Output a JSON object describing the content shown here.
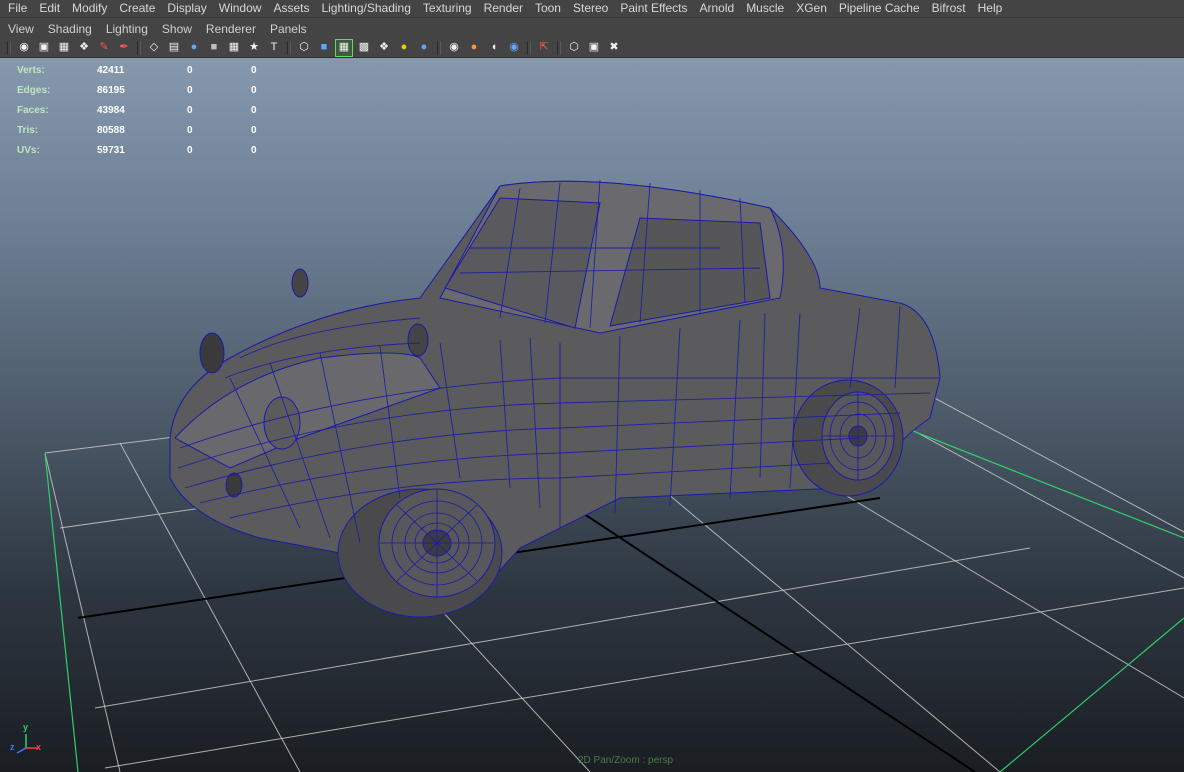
{
  "menu": [
    "File",
    "Edit",
    "Modify",
    "Create",
    "Display",
    "Window",
    "Assets",
    "Lighting/Shading",
    "Texturing",
    "Render",
    "Toon",
    "Stereo",
    "Paint Effects",
    "Arnold",
    "Muscle",
    "XGen",
    "Pipeline Cache",
    "Bifrost",
    "Help"
  ],
  "panel_menu": [
    "View",
    "Shading",
    "Lighting",
    "Show",
    "Renderer",
    "Panels"
  ],
  "toolbar_icons": [
    "camera-attributes-icon",
    "bookmark-icon",
    "image-plane-icon",
    "2d-pan-zoom-icon",
    "grease-pencil-icon",
    "paint-tool-icon",
    "wireframe-icon",
    "smooth-shade-icon",
    "wireframe-on-shaded-icon",
    "xray-icon",
    "xray-joints-icon",
    "isolate-icon",
    "resolution-gate-icon",
    "default-material-icon",
    "smooth-shaded-all-icon",
    "textured-icon",
    "checker-icon",
    "shadows-icon",
    "lights-icon",
    "ambient-occlusion-icon",
    "motion-blur-icon",
    "anti-aliasing-icon",
    "depth-of-field-icon",
    "select-camera-icon",
    "isolate-select-icon",
    "hud-icon",
    "toggle-gate-icon",
    "share-icon"
  ],
  "hud": {
    "rows": [
      {
        "label": "Verts:",
        "v1": "42411",
        "v2": "0",
        "v3": "0"
      },
      {
        "label": "Edges:",
        "v1": "86195",
        "v2": "0",
        "v3": "0"
      },
      {
        "label": "Faces:",
        "v1": "43984",
        "v2": "0",
        "v3": "0"
      },
      {
        "label": "Tris:",
        "v1": "80588",
        "v2": "0",
        "v3": "0"
      },
      {
        "label": "UVs:",
        "v1": "59731",
        "v2": "0",
        "v3": "0"
      }
    ]
  },
  "axis": {
    "y": "y",
    "x": "x",
    "z": "z"
  },
  "status": "2D Pan/Zoom : persp",
  "colors": {
    "ui_bg": "#444444",
    "wire": "#1a1aa8",
    "grid": "#c8c8c8",
    "grid_border": "#2fcf6a"
  }
}
